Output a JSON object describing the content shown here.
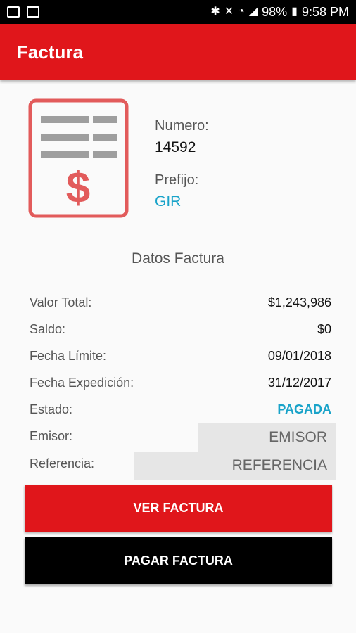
{
  "status_bar": {
    "battery": "98%",
    "time": "9:58 PM"
  },
  "app_bar": {
    "title": "Factura"
  },
  "invoice": {
    "numero_label": "Numero:",
    "numero_value": "14592",
    "prefijo_label": "Prefijo:",
    "prefijo_value": "GIR"
  },
  "section": {
    "title": "Datos Factura"
  },
  "details": {
    "valor_total_label": "Valor Total:",
    "valor_total_value": "$1,243,986",
    "saldo_label": "Saldo:",
    "saldo_value": "$0",
    "fecha_limite_label": "Fecha Límite:",
    "fecha_limite_value": "09/01/2018",
    "fecha_expedicion_label": "Fecha Expedición:",
    "fecha_expedicion_value": "31/12/2017",
    "estado_label": "Estado:",
    "estado_value": "PAGADA",
    "emisor_label": "Emisor:",
    "emisor_placeholder": "EMISOR",
    "referencia_label": "Referencia:",
    "referencia_placeholder": "REFERENCIA"
  },
  "buttons": {
    "ver_factura": "VER FACTURA",
    "pagar_factura": "PAGAR FACTURA"
  },
  "colors": {
    "primary_red": "#e0161b",
    "accent_blue": "#19a3c9",
    "icon_red": "#e25b5b"
  }
}
